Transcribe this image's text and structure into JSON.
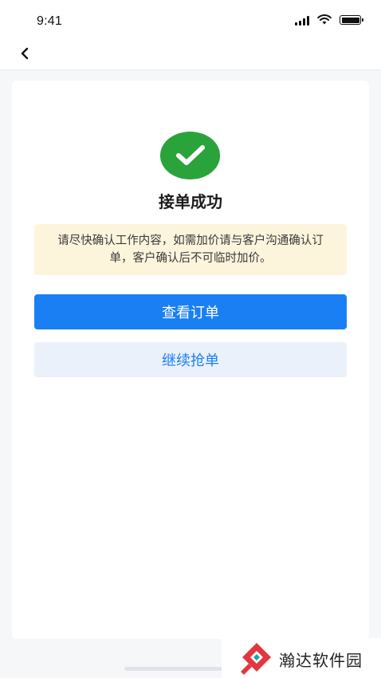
{
  "status_bar": {
    "time": "9:41"
  },
  "nav": {
    "back_icon": "chevron-left-icon"
  },
  "result": {
    "icon": "check-circle-icon",
    "icon_color": "#2aa33a",
    "title": "接单成功",
    "notice": "请尽快确认工作内容，如需加价请与客户沟通确认订单，客户确认后不可临时加价。"
  },
  "actions": {
    "view_order_label": "查看订单",
    "continue_label": "继续抢单",
    "primary_color": "#1a7ff2"
  },
  "watermark": {
    "text": "瀚达软件园"
  }
}
